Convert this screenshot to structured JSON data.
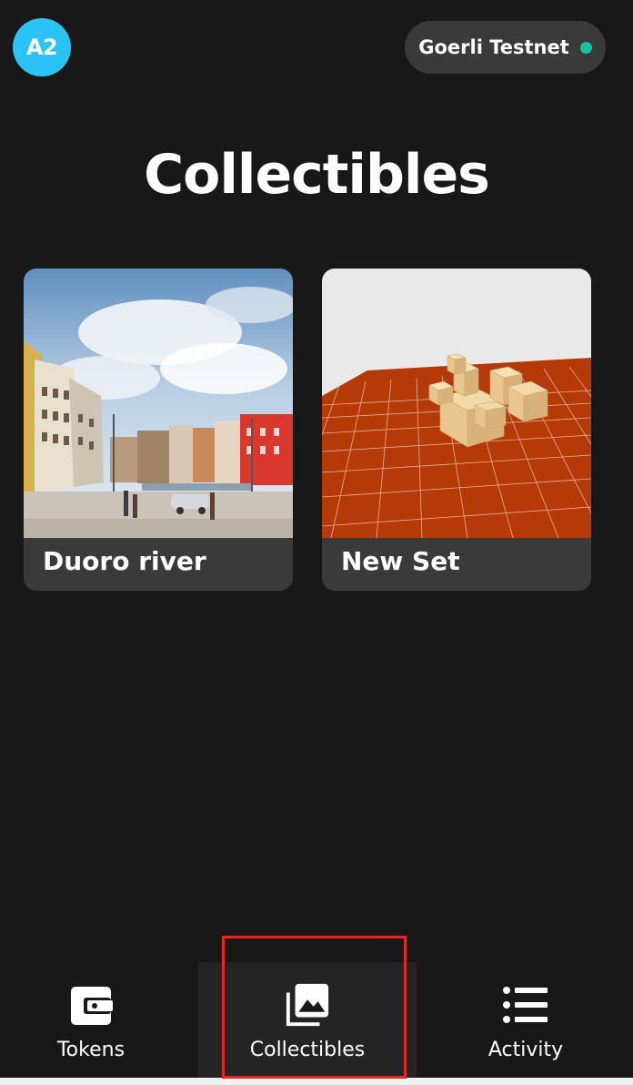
{
  "header": {
    "avatar_text": "A2",
    "network_name": "Goerli Testnet",
    "network_status_color": "#17c1a6",
    "avatar_color": "#2bc3f5"
  },
  "page": {
    "title": "Collectibles"
  },
  "collectibles": [
    {
      "label": "Duoro river",
      "image": "photo-of-riverside-town-square"
    },
    {
      "label": "New Set",
      "image": "3d-render-of-cube-structure-on-orange-grid"
    }
  ],
  "nav": {
    "items": [
      {
        "label": "Tokens",
        "icon": "wallet-icon",
        "active": false
      },
      {
        "label": "Collectibles",
        "icon": "image-gallery-icon",
        "active": true
      },
      {
        "label": "Activity",
        "icon": "list-icon",
        "active": false
      }
    ]
  },
  "colors": {
    "background": "#181818",
    "surface": "#3a3a3a",
    "highlight": "#e8261f"
  }
}
